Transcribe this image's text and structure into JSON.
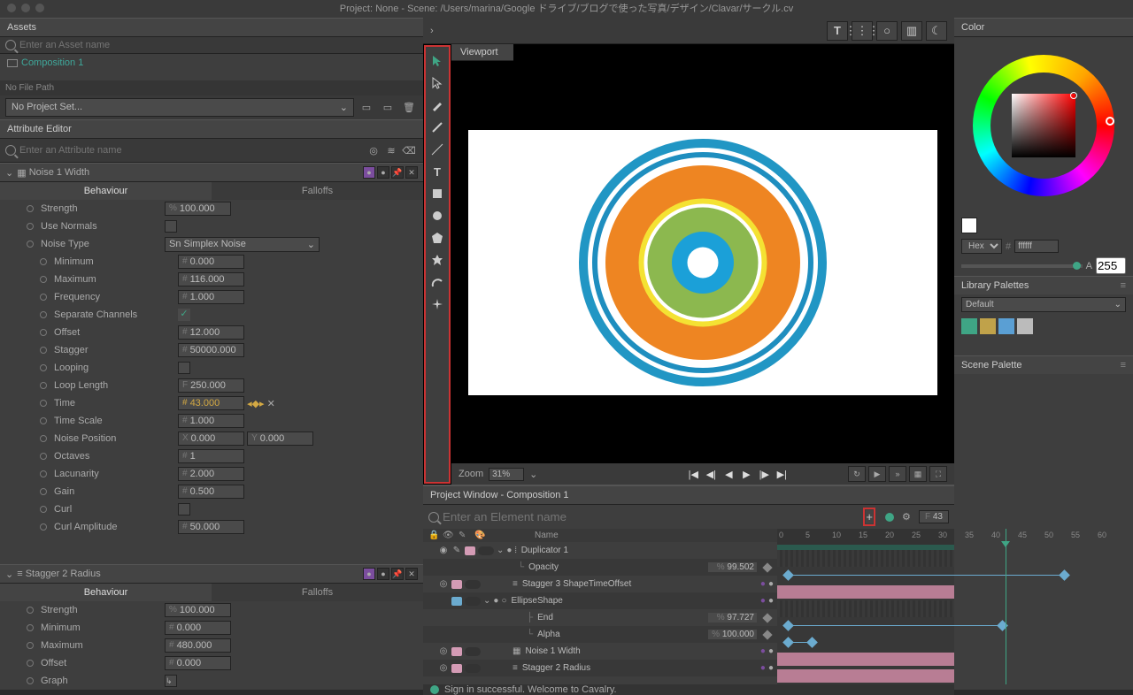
{
  "titlebar": "Project: None - Scene: /Users/marina/Google ドライブ/ブログで使った写真/デザイン/Clavar/サークル.cv",
  "assets": {
    "header": "Assets",
    "search_ph": "Enter an Asset name",
    "item": "Composition 1",
    "no_path": "No File Path",
    "project_sel": "No Project Set..."
  },
  "attr": {
    "header": "Attribute Editor",
    "search_ph": "Enter an Attribute name",
    "group1": "Noise 1 Width",
    "group2": "Stagger 2 Radius",
    "tabs": {
      "behaviour": "Behaviour",
      "falloffs": "Falloffs"
    },
    "rows1": {
      "strength": {
        "l": "Strength",
        "p": "%",
        "v": "100.000"
      },
      "use_normals": {
        "l": "Use Normals"
      },
      "noise_type": {
        "l": "Noise Type",
        "v": "Simplex Noise",
        "p": "Sn"
      },
      "minimum": {
        "l": "Minimum",
        "p": "#",
        "v": "0.000"
      },
      "maximum": {
        "l": "Maximum",
        "p": "#",
        "v": "116.000"
      },
      "frequency": {
        "l": "Frequency",
        "p": "#",
        "v": "1.000"
      },
      "sep_channels": {
        "l": "Separate Channels"
      },
      "offset": {
        "l": "Offset",
        "p": "#",
        "v": "12.000"
      },
      "stagger": {
        "l": "Stagger",
        "p": "#",
        "v": "50000.000"
      },
      "looping": {
        "l": "Looping"
      },
      "loop_length": {
        "l": "Loop Length",
        "p": "F",
        "v": "250.000"
      },
      "time": {
        "l": "Time",
        "p": "#",
        "v": "43.000"
      },
      "time_scale": {
        "l": "Time Scale",
        "p": "#",
        "v": "1.000"
      },
      "noise_pos": {
        "l": "Noise Position",
        "px": "X",
        "vx": "0.000",
        "py": "Y",
        "vy": "0.000"
      },
      "octaves": {
        "l": "Octaves",
        "p": "#",
        "v": "1"
      },
      "lacunarity": {
        "l": "Lacunarity",
        "p": "#",
        "v": "2.000"
      },
      "gain": {
        "l": "Gain",
        "p": "#",
        "v": "0.500"
      },
      "curl": {
        "l": "Curl"
      },
      "curl_amp": {
        "l": "Curl Amplitude",
        "p": "#",
        "v": "50.000"
      }
    },
    "rows2": {
      "strength": {
        "l": "Strength",
        "p": "%",
        "v": "100.000"
      },
      "minimum": {
        "l": "Minimum",
        "p": "#",
        "v": "0.000"
      },
      "maximum": {
        "l": "Maximum",
        "p": "#",
        "v": "480.000"
      },
      "offset": {
        "l": "Offset",
        "p": "#",
        "v": "0.000"
      },
      "graph": {
        "l": "Graph"
      }
    }
  },
  "viewport": {
    "tab": "Viewport",
    "zoom_label": "Zoom",
    "zoom": "31%"
  },
  "projwin": {
    "header": "Project Window - Composition 1",
    "search_ph": "Enter an Element name",
    "frame_label": "F",
    "frame": "43",
    "col_name": "Name",
    "layers": {
      "dup": "Duplicator 1",
      "opacity": {
        "l": "Opacity",
        "p": "%",
        "v": "99.502"
      },
      "stagger3": "Stagger 3 ShapeTimeOffset",
      "ellipse": "EllipseShape",
      "end": {
        "l": "End",
        "p": "%",
        "v": "97.727"
      },
      "alpha": {
        "l": "Alpha",
        "p": "%",
        "v": "100.000"
      },
      "noise1": "Noise 1 Width",
      "stagger2": "Stagger 2 Radius"
    },
    "ruler": [
      "0",
      "5",
      "10",
      "15",
      "20",
      "25",
      "30",
      "35",
      "40",
      "45",
      "50",
      "55",
      "60"
    ]
  },
  "color": {
    "header": "Color",
    "mode": "Hex",
    "hex": "ffffff",
    "alpha_label": "A",
    "alpha": "255",
    "lib_header": "Library Palettes",
    "lib_sel": "Default",
    "pal": [
      "#3fa585",
      "#c0a24a",
      "#5a9fd4",
      "#bbbbbb"
    ],
    "scene_header": "Scene Palette"
  },
  "status": {
    "message": "Sign in successful. Welcome to Cavalry."
  }
}
